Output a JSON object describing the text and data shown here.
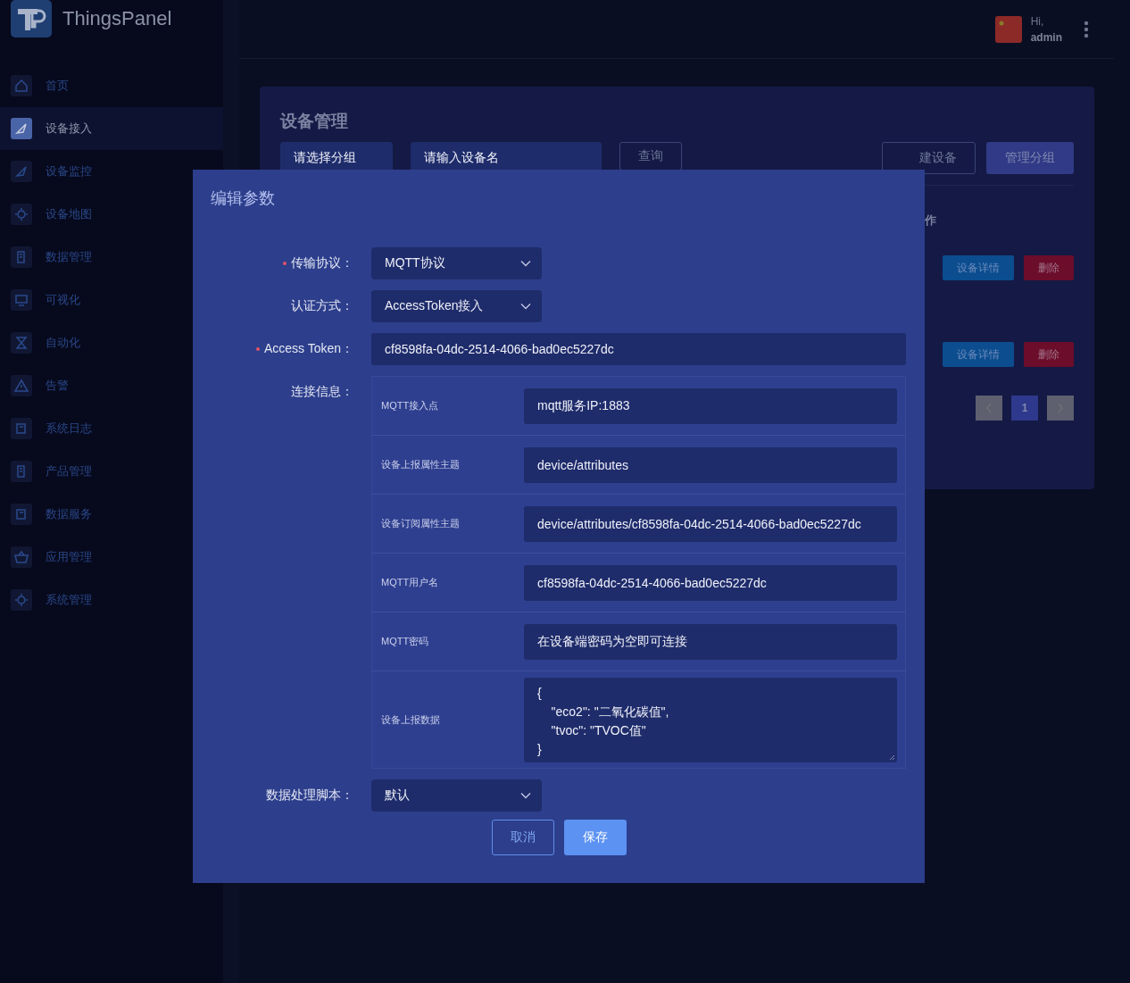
{
  "app": {
    "logo_text": "ThingsPanel"
  },
  "sidebar": {
    "items": [
      {
        "label": "首页",
        "selected": false
      },
      {
        "label": "设备接入",
        "selected": true
      },
      {
        "label": "设备监控",
        "selected": false
      },
      {
        "label": "设备地图",
        "selected": false
      },
      {
        "label": "数据管理",
        "selected": false
      },
      {
        "label": "可视化",
        "selected": false
      },
      {
        "label": "自动化",
        "selected": false
      },
      {
        "label": "告警",
        "selected": false
      },
      {
        "label": "系统日志",
        "selected": false
      },
      {
        "label": "产品管理",
        "selected": false
      },
      {
        "label": "数据服务",
        "selected": false
      },
      {
        "label": "应用管理",
        "selected": false
      },
      {
        "label": "系统管理",
        "selected": false
      }
    ]
  },
  "header": {
    "greeting": "Hi,",
    "user": "admin"
  },
  "page": {
    "title": "设备管理",
    "filters": [
      {
        "placeholder": "请选择分组",
        "kind": "select"
      },
      {
        "placeholder": "请输入设备名",
        "kind": "input"
      }
    ],
    "search_button": "查询",
    "actions": [
      {
        "label": "建设备",
        "kind": "outline"
      },
      {
        "label": "管理分组",
        "kind": "filled"
      }
    ],
    "table": {
      "column_header": "作",
      "rows": [
        {
          "actions": [
            {
              "label": "设备详情",
              "kind": "info"
            },
            {
              "label": "删除",
              "kind": "danger"
            }
          ]
        },
        {
          "actions": [
            {
              "label": "设备详情",
              "kind": "info"
            },
            {
              "label": "删除",
              "kind": "danger"
            }
          ]
        }
      ]
    },
    "pagination": {
      "pages": [
        {
          "label": "1",
          "selected": true
        }
      ]
    }
  },
  "modal": {
    "title": "编辑参数",
    "fields": [
      {
        "label": "传输协议：",
        "required": true,
        "kind": "select",
        "value": "MQTT协议"
      },
      {
        "label": "认证方式：",
        "required": false,
        "kind": "select",
        "value": "AccessToken接入"
      },
      {
        "label": "Access Token：",
        "required": true,
        "kind": "input",
        "value": "cf8598fa-04dc-2514-4066-bad0ec5227dc"
      },
      {
        "label": "连接信息：",
        "required": false,
        "kind": "table",
        "rows": [
          {
            "name": "MQTT接入点",
            "value": "mqtt服务IP:1883",
            "kind": "line"
          },
          {
            "name": "设备上报属性主题",
            "value": "device/attributes",
            "kind": "line"
          },
          {
            "name": "设备订阅属性主题",
            "value": "device/attributes/cf8598fa-04dc-2514-4066-bad0ec5227dc",
            "kind": "line"
          },
          {
            "name": "MQTT用户名",
            "value": "cf8598fa-04dc-2514-4066-bad0ec5227dc",
            "kind": "line"
          },
          {
            "name": "MQTT密码",
            "value": "在设备端密码为空即可连接",
            "kind": "line"
          },
          {
            "name": "设备上报数据",
            "value": "{\n    \"eco2\": \"二氧化碳值\",\n    \"tvoc\": \"TVOC值\"\n}",
            "kind": "multiline"
          }
        ]
      },
      {
        "label": "数据处理脚本：",
        "required": false,
        "kind": "select",
        "value": "默认"
      }
    ],
    "buttons": [
      {
        "label": "取消",
        "kind": "cancel"
      },
      {
        "label": "保存",
        "kind": "primary"
      }
    ]
  }
}
